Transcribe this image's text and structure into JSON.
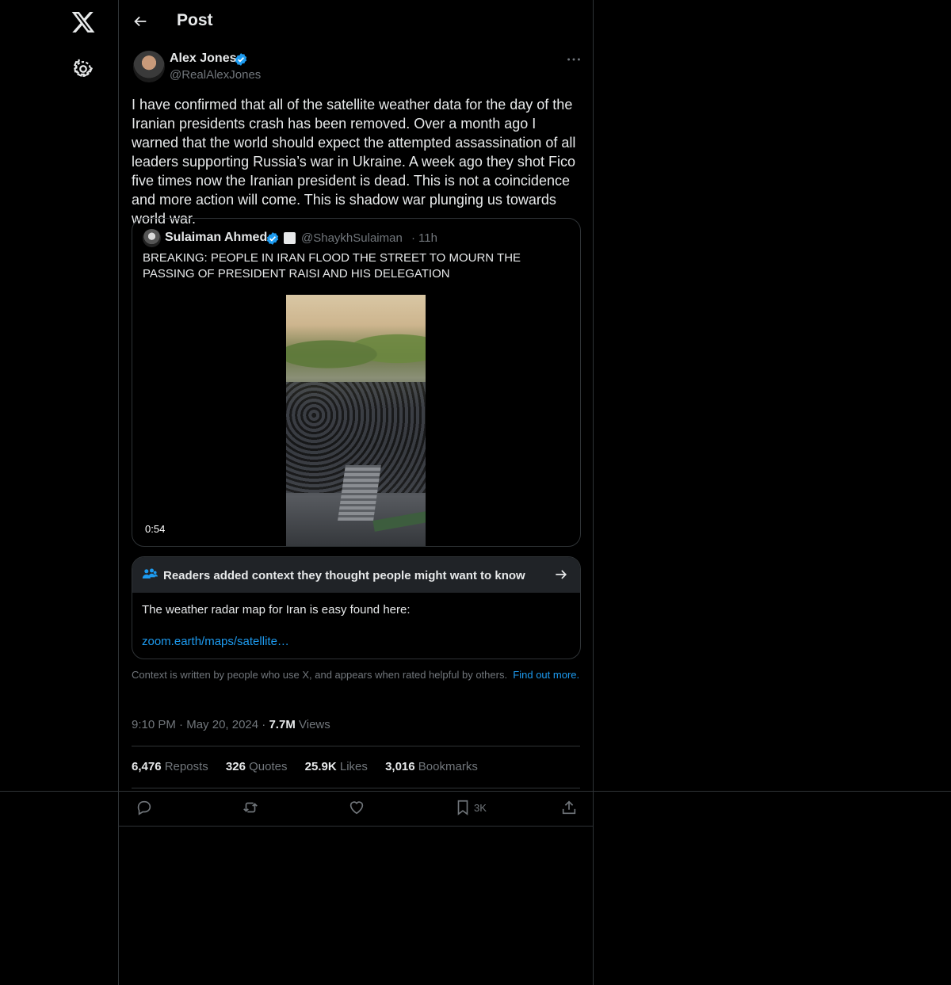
{
  "header": {
    "title": "Post"
  },
  "post": {
    "author_name": "Alex Jones",
    "author_handle": "@RealAlexJones",
    "text": "I have confirmed that all of the satellite weather data for the day of the Iranian presidents crash has been removed. Over a month ago I warned that the world should expect the attempted assassination of all leaders supporting Russia’s war in Ukraine. A week ago they shot Fico five times now the Iranian president is dead. This is not a coincidence and more action will come. This is shadow war plunging us towards world war.",
    "time": "9:10 PM",
    "date": "May 20, 2024",
    "views_count": "7.7M",
    "views_label": "Views"
  },
  "quote": {
    "author_name": "Sulaiman Ahmed",
    "author_handle": "@ShaykhSulaiman",
    "time": "11h",
    "text": "BREAKING: PEOPLE IN IRAN FLOOD THE STREET TO MOURN THE PASSING OF PRESIDENT RAISI AND HIS DELEGATION",
    "video_duration": "0:54"
  },
  "community_note": {
    "title": "Readers added context they thought people might want to know",
    "body": "The weather radar map for Iran is easy found here:",
    "link": "zoom.earth/maps/satellite…"
  },
  "context_footer": {
    "text": "Context is written by people who use X, and appears when rated helpful by others.",
    "link": "Find out more."
  },
  "stats": {
    "reposts_count": "6,476",
    "reposts_label": "Reposts",
    "quotes_count": "326",
    "quotes_label": "Quotes",
    "likes_count": "25.9K",
    "likes_label": "Likes",
    "bookmarks_count": "3,016",
    "bookmarks_label": "Bookmarks"
  },
  "actions": {
    "bookmark_count": "3K"
  },
  "icons": [
    "x-logo-icon",
    "gear-icon",
    "back-arrow-icon",
    "verified-icon",
    "more-icon",
    "people-icon",
    "arrow-right-icon",
    "reply-icon",
    "repost-icon",
    "like-icon",
    "bookmark-icon",
    "share-icon"
  ],
  "colors": {
    "background": "#000000",
    "text": "#e7e9ea",
    "muted": "#71767b",
    "accent": "#1d9bf0",
    "border": "#2f3336",
    "note_header": "#202327"
  }
}
